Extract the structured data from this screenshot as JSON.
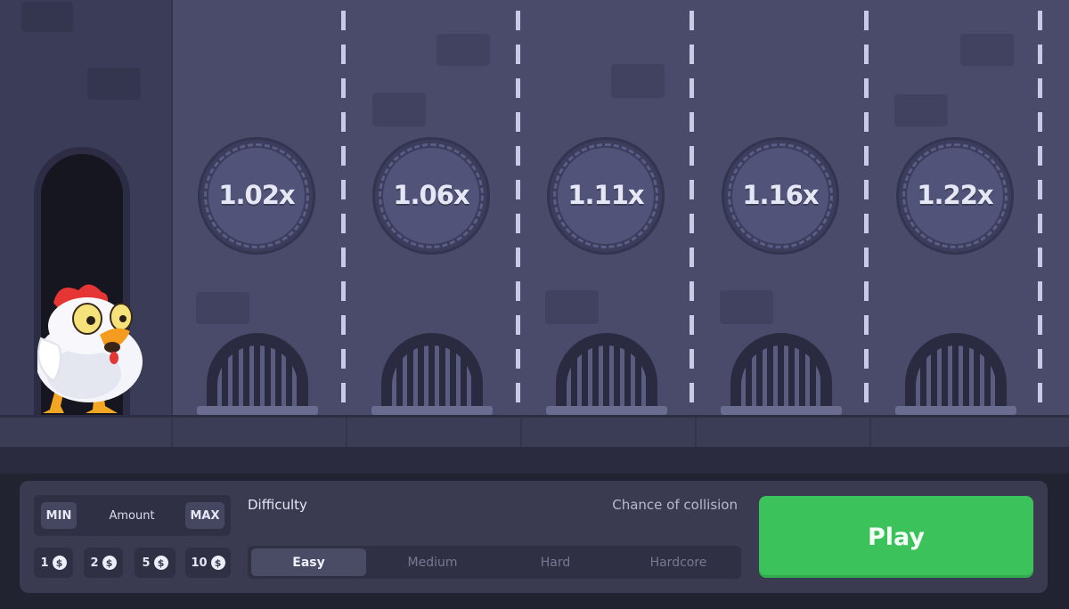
{
  "multipliers": [
    {
      "label": "1.02x"
    },
    {
      "label": "1.06x"
    },
    {
      "label": "1.11x"
    },
    {
      "label": "1.16x"
    },
    {
      "label": "1.22x"
    }
  ],
  "bet": {
    "min_label": "MIN",
    "amount_label": "Amount",
    "max_label": "MAX",
    "quick_amounts": [
      "1",
      "2",
      "5",
      "10"
    ],
    "currency_icon": "$"
  },
  "difficulty": {
    "label": "Difficulty",
    "collision_label": "Chance of collision",
    "options": [
      "Easy",
      "Medium",
      "Hard",
      "Hardcore"
    ],
    "selected": "Easy"
  },
  "play_button": {
    "label": "Play"
  },
  "colors": {
    "play_green": "#3cc25a",
    "background": "#4a4b6a",
    "panel": "#3a3b51"
  }
}
